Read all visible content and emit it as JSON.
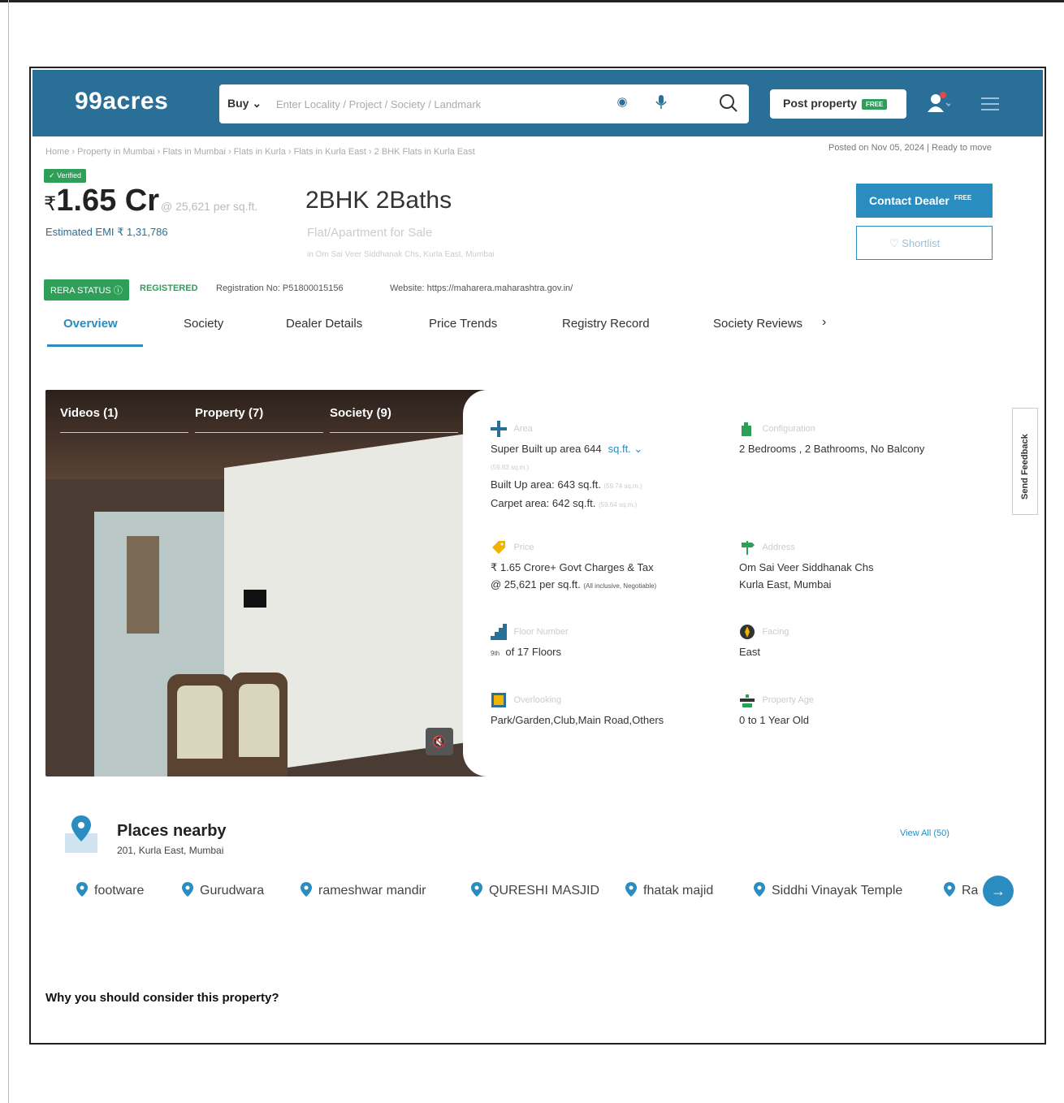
{
  "header": {
    "logo": "99acres",
    "buy_label": "Buy ⌄",
    "search_placeholder": "Enter Locality / Project / Society / Landmark",
    "post_property_label": "Post property",
    "free_tag": "FREE",
    "brand_color": "#2a6f98"
  },
  "breadcrumb": "Home › Property in Mumbai › Flats in Mumbai › Flats in Kurla › Flats in Kurla East › 2 BHK Flats in Kurla East",
  "posted": "Posted on Nov 05, 2024  |  Ready to move",
  "listing": {
    "verified": "✓ Verified",
    "price_symbol": "₹",
    "price": "1.65 Cr",
    "per_sqft": "@ 25,621 per sq.ft.",
    "emi": "Estimated EMI ₹ 1,31,786",
    "title": "2BHK 2Baths",
    "subtitle": "Flat/Apartment for Sale",
    "location": "in Om Sai Veer Siddhanak Chs, Kurla East, Mumbai",
    "contact_label": "Contact Dealer",
    "contact_free": "FREE",
    "shortlist_label": "Shortlist"
  },
  "rera": {
    "badge": "RERA STATUS",
    "status": "REGISTERED",
    "reg_no": "Registration No: P51800015156",
    "website": "Website: https://maharera.maharashtra.gov.in/"
  },
  "tabs": [
    "Overview",
    "Society",
    "Dealer Details",
    "Price Trends",
    "Registry Record",
    "Society Reviews"
  ],
  "tab_next": "›",
  "media": {
    "tabs": [
      "Videos (1)",
      "Property (7)",
      "Society (9)"
    ],
    "mute": "🔇"
  },
  "details": {
    "area": {
      "label": "Area",
      "super": "Super Built up area 644",
      "unit": "sq.ft. ⌄",
      "super_sub": "(59.83 sq.m.)",
      "built": "Built Up area: 643 sq.ft.",
      "built_sub": "(59.74 sq.m.)",
      "carpet": "Carpet area: 642 sq.ft.",
      "carpet_sub": "(59.64 sq.m.)"
    },
    "configuration": {
      "label": "Configuration",
      "value": "2 Bedrooms , 2 Bathrooms, No Balcony"
    },
    "price": {
      "label": "Price",
      "line1": "₹ 1.65 Crore+ Govt Charges & Tax",
      "line2": "@ 25,621 per sq.ft.",
      "line2_sub": "(All inclusive, Negotiable)"
    },
    "address": {
      "label": "Address",
      "line1": "Om Sai Veer Siddhanak Chs",
      "line2": "Kurla East, Mumbai"
    },
    "floor": {
      "label": "Floor Number",
      "sup": "9th",
      "value": "of 17 Floors"
    },
    "facing": {
      "label": "Facing",
      "value": "East"
    },
    "overlooking": {
      "label": "Overlooking",
      "value": "Park/Garden,Club,Main Road,Others"
    },
    "age": {
      "label": "Property Age",
      "value": "0 to 1 Year Old"
    }
  },
  "feedback": "Send Feedback",
  "places": {
    "title": "Places nearby",
    "subtitle": "201, Kurla East, Mumbai",
    "view_all": "View All (50)",
    "items": [
      "footware",
      "Gurudwara",
      "rameshwar mandir",
      "QURESHI MASJID",
      "fhatak majid",
      "Siddhi Vinayak Temple",
      "Ra"
    ],
    "next": "→"
  },
  "why": "Why you should consider this property?"
}
